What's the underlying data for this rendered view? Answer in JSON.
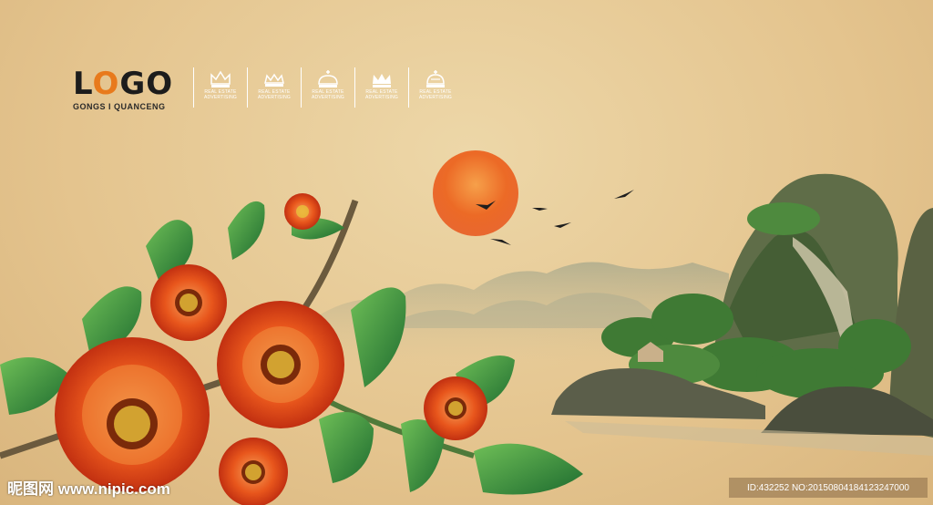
{
  "logo": {
    "text_before": "L",
    "text_accent": "O",
    "text_after": "GO",
    "subtitle": "GONGS I QUANCENG"
  },
  "crowns": [
    {
      "icon": "crown-icon",
      "line1": "REAL ESTATE",
      "line2": "ADVERTISING"
    },
    {
      "icon": "crown-icon",
      "line1": "REAL ESTATE",
      "line2": "ADVERTISING"
    },
    {
      "icon": "crown-icon",
      "line1": "REAL ESTATE",
      "line2": "ADVERTISING"
    },
    {
      "icon": "crown-icon",
      "line1": "REAL ESTATE",
      "line2": "ADVERTISING"
    },
    {
      "icon": "crown-icon",
      "line1": "REAL ESTATE",
      "line2": "ADVERTISING"
    }
  ],
  "watermark": {
    "left": "昵图网 www.nipic.com",
    "right": "ID:432252 NO:20150804184123247000"
  },
  "colors": {
    "background": "#e4c48e",
    "sun": "#e8561c",
    "flower": "#d9451a",
    "leaf": "#2f8a3c",
    "logo_accent": "#e87a1c"
  }
}
